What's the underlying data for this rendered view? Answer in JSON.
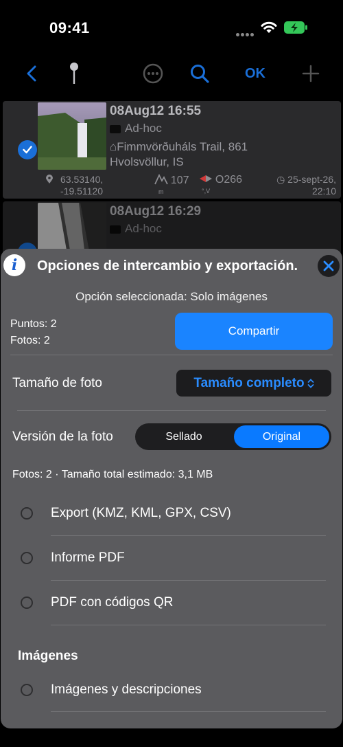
{
  "status": {
    "time": "09:41"
  },
  "nav": {
    "ok_label": "OK"
  },
  "cards": [
    {
      "title": "08Aug12 16:55",
      "folder": "Ad-hoc",
      "place_line1": "⌂Fimmvörðuháls Trail, 861",
      "place_line2": "Hvolsvöllur, IS",
      "lat": "63.53140,",
      "lon": "-19.51120",
      "altitude": "107",
      "altitude_unit": "m",
      "heading": "O266",
      "heading_unit": "°,V",
      "date_line1": "◷ 25-sept-26,",
      "date_line2": "22:10"
    },
    {
      "title": "08Aug12 16:29",
      "folder": "Ad-hoc"
    }
  ],
  "sheet": {
    "title": "Opciones de intercambio y exportación.",
    "selected_option": "Opción seleccionada: Solo imágenes",
    "points": "Puntos: 2",
    "photos": "Fotos: 2",
    "share_label": "Compartir",
    "photo_size_label": "Tamaño de foto",
    "photo_size_value": "Tamaño completo",
    "photo_version_label": "Versión de la foto",
    "version_options": [
      "Sellado",
      "Original"
    ],
    "estimate": "Fotos: 2 · Tamaño total estimado: 3,1 MB",
    "export_options": [
      "Export (KMZ, KML, GPX, CSV)",
      "Informe PDF",
      "PDF con códigos QR"
    ],
    "images_section": "Imágenes",
    "image_options": [
      "Imágenes y descripciones"
    ]
  },
  "colors": {
    "accent": "#1a84ff",
    "sheet_bg": "#5b5b5e",
    "card_bg": "#2a2a2c"
  }
}
